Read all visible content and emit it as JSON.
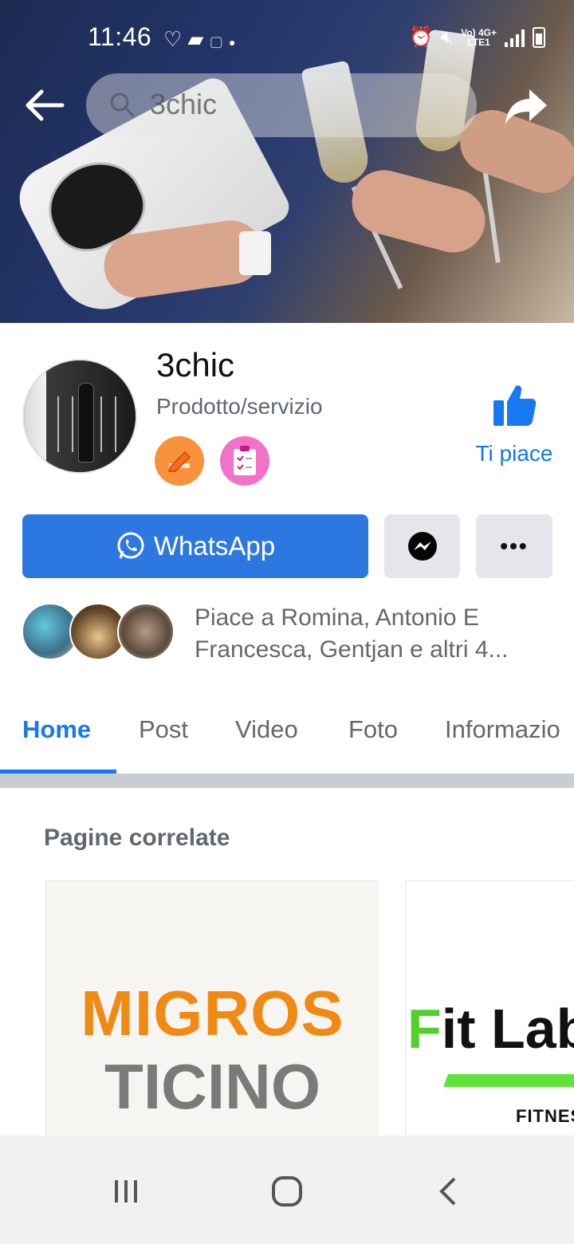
{
  "status_bar": {
    "time": "11:46",
    "network_label": "Vo) 4G+\nLTE1",
    "icons_left": [
      "heart-check-icon",
      "message-icon",
      "gallery-icon",
      "dot-icon"
    ],
    "icons_right": [
      "alarm-icon",
      "mute-icon",
      "network-icon",
      "signal-icon",
      "battery-icon"
    ]
  },
  "header": {
    "search_text": "3chic"
  },
  "page": {
    "name": "3chic",
    "category": "Prodotto/servizio",
    "like_label": "Ti piace"
  },
  "actions": {
    "whatsapp_label": "WhatsApp",
    "more_label": "•••"
  },
  "friends": {
    "liked_by": "Piace a Romina, Antonio E Francesca, Gentjan e altri 4..."
  },
  "tabs": [
    {
      "label": "Home",
      "active": true
    },
    {
      "label": "Post",
      "active": false
    },
    {
      "label": "Video",
      "active": false
    },
    {
      "label": "Foto",
      "active": false
    },
    {
      "label": "Informazio",
      "active": false
    }
  ],
  "related": {
    "title": "Pagine correlate",
    "cards": [
      {
        "line1": "MIGROS",
        "line2": "TICINO"
      },
      {
        "line1": "Fit Lab",
        "line2": "FITNESS"
      }
    ]
  },
  "colors": {
    "accent": "#1877f2",
    "whatsapp_button": "#2d78e0",
    "migros_orange": "#f08a13",
    "fit_green": "#52d12a"
  }
}
